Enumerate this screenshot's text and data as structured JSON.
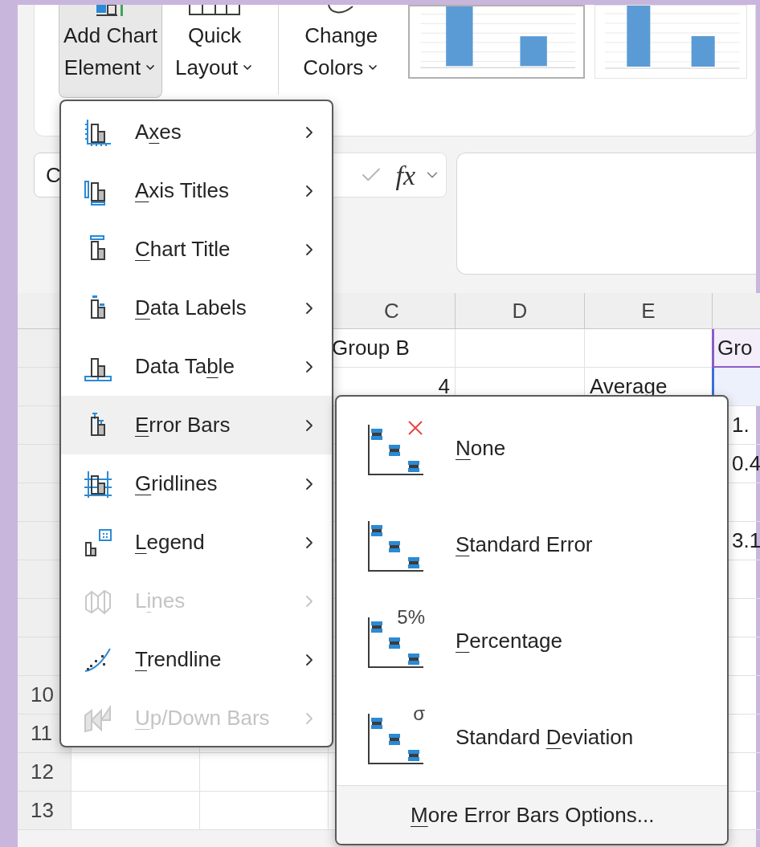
{
  "ribbon": {
    "buttons": [
      {
        "kind": "add_chart",
        "lines": [
          "Add Chart",
          "Element"
        ],
        "selected": true,
        "dropdown": true
      },
      {
        "kind": "quick_layout",
        "lines": [
          "Quick",
          "Layout"
        ],
        "selected": false,
        "dropdown": true
      },
      {
        "kind": "change_colors",
        "lines": [
          "Change",
          "Colors"
        ],
        "selected": false,
        "dropdown": true
      }
    ],
    "chart_styles": [
      {
        "selected": true
      },
      {
        "selected": false
      }
    ]
  },
  "formula_bar": {
    "name_box": "C",
    "function_label": "fx"
  },
  "sheet": {
    "column_headers": [
      "C",
      "D",
      "E"
    ],
    "rows": [
      {
        "c": "Group B",
        "f": {
          "text": "Gro",
          "color": "#8c5cc9"
        }
      },
      {
        "c": "4",
        "e": "Average",
        "f": {
          "color": "#3b6fd6"
        }
      },
      {
        "f": {
          "text": "1."
        }
      },
      {
        "f": {
          "text": "0.4"
        }
      },
      {},
      {
        "f": {
          "text": "3.1"
        }
      },
      {},
      {},
      {},
      {
        "number": "10"
      },
      {
        "number": "11"
      },
      {
        "number": "12"
      },
      {
        "number": "13"
      }
    ]
  },
  "chart_element_menu": {
    "items": [
      {
        "kind": "axes",
        "label": {
          "before": "A",
          "key": "x",
          "after": "es"
        },
        "disabled": false,
        "selected": false
      },
      {
        "kind": "axis_titles",
        "label": {
          "key": "A",
          "after": "xis Titles"
        },
        "disabled": false,
        "selected": false
      },
      {
        "kind": "chart_title",
        "label": {
          "key": "C",
          "after": "hart Title"
        },
        "disabled": false,
        "selected": false
      },
      {
        "kind": "data_labels",
        "label": {
          "key": "D",
          "after": "ata Labels"
        },
        "disabled": false,
        "selected": false
      },
      {
        "kind": "data_table",
        "label": {
          "before": "Data Ta",
          "key": "b",
          "after": "le"
        },
        "disabled": false,
        "selected": false
      },
      {
        "kind": "error_bars",
        "label": {
          "key": "E",
          "after": "rror Bars"
        },
        "disabled": false,
        "selected": true
      },
      {
        "kind": "gridlines",
        "label": {
          "key": "G",
          "after": "ridlines"
        },
        "disabled": false,
        "selected": false
      },
      {
        "kind": "legend",
        "label": {
          "key": "L",
          "after": "egend"
        },
        "disabled": false,
        "selected": false
      },
      {
        "kind": "lines",
        "label": {
          "before": "L",
          "key": "i",
          "after": "nes"
        },
        "disabled": true,
        "selected": false
      },
      {
        "kind": "trendline",
        "label": {
          "key": "T",
          "after": "rendline"
        },
        "disabled": false,
        "selected": false
      },
      {
        "kind": "updown_bars",
        "label": {
          "key": "U",
          "after": "p/Down Bars"
        },
        "disabled": true,
        "selected": false
      }
    ]
  },
  "error_bars_submenu": {
    "items": [
      {
        "kind": "none",
        "label": {
          "key": "N",
          "after": "one"
        }
      },
      {
        "kind": "standard_error",
        "label": {
          "key": "S",
          "after": "tandard Error"
        }
      },
      {
        "kind": "percentage",
        "icon_text": "5%",
        "label": {
          "key": "P",
          "after": "ercentage"
        }
      },
      {
        "kind": "standard_deviation",
        "icon_text": "σ",
        "label": {
          "before": "Standard ",
          "key": "D",
          "after": "eviation"
        }
      }
    ],
    "footer": {
      "label": {
        "key": "M",
        "after": "ore Error Bars Options..."
      }
    }
  }
}
